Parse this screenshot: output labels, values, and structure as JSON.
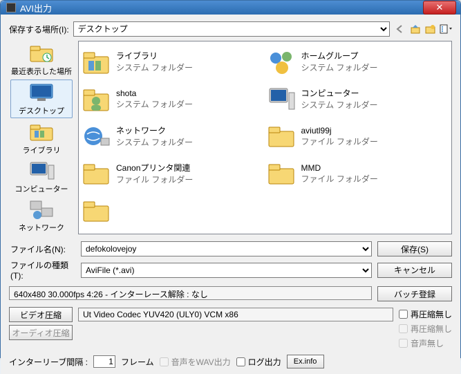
{
  "window": {
    "title": "AVI出力"
  },
  "save_in": {
    "label": "保存する場所(I):",
    "value": "デスクトップ"
  },
  "nav_icons": [
    "back-arrow",
    "up-arrow",
    "new-folder",
    "view-menu"
  ],
  "sidebar": {
    "items": [
      {
        "label": "最近表示した場所",
        "icon": "recent"
      },
      {
        "label": "デスクトップ",
        "icon": "desktop",
        "selected": true
      },
      {
        "label": "ライブラリ",
        "icon": "library"
      },
      {
        "label": "コンピューター",
        "icon": "computer"
      },
      {
        "label": "ネットワーク",
        "icon": "network"
      }
    ]
  },
  "files": [
    {
      "name": "ライブラリ",
      "sub": "システム フォルダー",
      "icon": "library"
    },
    {
      "name": "ホームグループ",
      "sub": "システム フォルダー",
      "icon": "homegroup"
    },
    {
      "name": "shota",
      "sub": "システム フォルダー",
      "icon": "user"
    },
    {
      "name": "コンピューター",
      "sub": "システム フォルダー",
      "icon": "computer"
    },
    {
      "name": "ネットワーク",
      "sub": "システム フォルダー",
      "icon": "network"
    },
    {
      "name": "aviutl99j",
      "sub": "ファイル フォルダー",
      "icon": "folder"
    },
    {
      "name": "Canonプリンタ関連",
      "sub": "ファイル フォルダー",
      "icon": "folder"
    },
    {
      "name": "MMD",
      "sub": "ファイル フォルダー",
      "icon": "folder"
    }
  ],
  "filename": {
    "label": "ファイル名(N):",
    "value": "defokolovejoy"
  },
  "filetype": {
    "label": "ファイルの種類(T):",
    "value": "AviFile (*.avi)"
  },
  "buttons": {
    "save": "保存(S)",
    "cancel": "キャンセル",
    "batch": "バッチ登録",
    "video_comp": "ビデオ圧縮",
    "audio_comp": "オーディオ圧縮",
    "exinfo": "Ex.info"
  },
  "status": "640x480  30.000fps  4:26  -  インターレース解除 : なし",
  "codec_info": "Ut Video Codec YUV420 (ULY0) VCM x86",
  "checks": {
    "no_recompress1": "再圧縮無し",
    "no_recompress2": "再圧縮無し",
    "no_audio": "音声無し",
    "audio_wav": "音声をWAV出力",
    "log_out": "ログ出力"
  },
  "interleave": {
    "label": "インターリーブ間隔 :",
    "value": "1",
    "unit": "フレーム"
  }
}
